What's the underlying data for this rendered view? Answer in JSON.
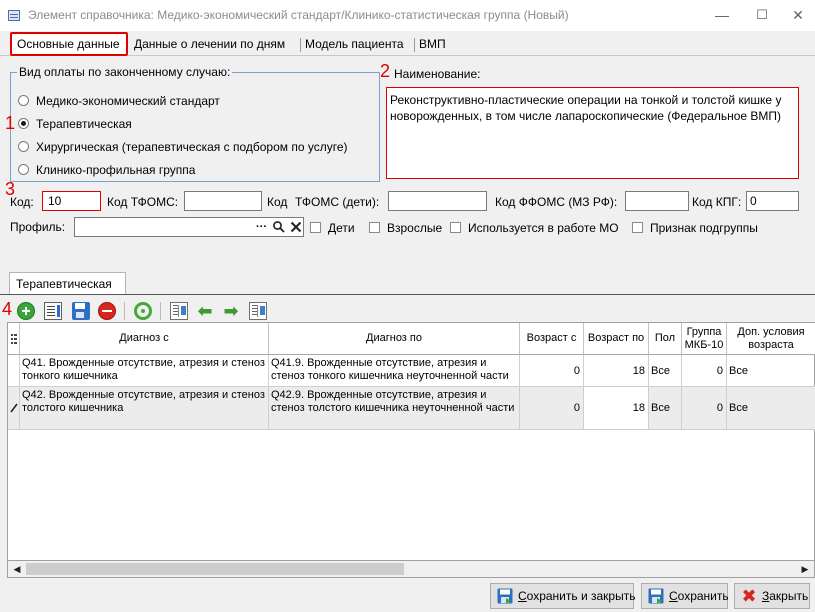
{
  "window": {
    "title": "Элемент справочника: Медико-экономический стандарт/Клинико-статистическая группа (Новый)",
    "minimize": "—",
    "maximize": "☐",
    "close": "✕"
  },
  "tabs": [
    {
      "label": "Основные данные",
      "active": true
    },
    {
      "label": "Данные о лечении по дням"
    },
    {
      "label": "Модель пациента"
    },
    {
      "label": "ВМП"
    }
  ],
  "annotations": [
    "1",
    "2",
    "3",
    "4"
  ],
  "payment": {
    "legend": "Вид оплаты по законченному случаю:",
    "options": [
      {
        "label": "Медико-экономический стандарт",
        "selected": false
      },
      {
        "label": "Терапевтическая",
        "selected": true
      },
      {
        "label": "Хирургическая (терапевтическая с подбором по услуге)",
        "selected": false
      },
      {
        "label": "Клинико-профильная группа",
        "selected": false
      }
    ]
  },
  "name": {
    "label": "Наименование:",
    "value": "Реконструктивно-пластические операции на тонкой и толстой кишке у новорожденных, в том числе лапароскопические (Федеральное ВМП)"
  },
  "codes": {
    "code_label": "Код:",
    "code_value": "10",
    "tfoms_label": "Код ТФОМС:",
    "tfoms_value": "",
    "tfoms_child_label1": "Код",
    "tfoms_child_label2": "ТФОМС (дети):",
    "tfoms_child_value": "",
    "ffoms_label": "Код ФФОМС (МЗ РФ):",
    "ffoms_value": "",
    "kpg_label": "Код КПГ:",
    "kpg_value": "0"
  },
  "profile": {
    "label": "Профиль:",
    "value": "",
    "dots": "···",
    "checkboxes": [
      {
        "label": "Дети",
        "checked": false
      },
      {
        "label": "Взрослые",
        "checked": false
      },
      {
        "label": "Используется в работе МО",
        "checked": false
      },
      {
        "label": "Признак подгруппы",
        "checked": false
      }
    ]
  },
  "subtab": {
    "label": "Терапевтическая"
  },
  "grid": {
    "columns": [
      "Диагноз с",
      "Диагноз по",
      "Возраст с",
      "Возраст по",
      "Пол",
      "Группа МКБ-10",
      "Доп. условия возраста"
    ],
    "rows": [
      {
        "diag_from": "Q41. Врожденные отсутствие, атрезия и стеноз тонкого кишечника",
        "diag_to": "Q41.9. Врожденные отсутствие, атрезия и стеноз тонкого кишечника неуточненной части",
        "age_from": "0",
        "age_to": "18",
        "sex": "Все",
        "group": "0",
        "extra": "Все"
      },
      {
        "diag_from": "Q42. Врожденные отсутствие, атрезия и стеноз толстого кишечника",
        "diag_to": "Q42.9. Врожденные отсутствие, атрезия и стеноз толстого кишечника неуточненной части",
        "age_from": "0",
        "age_to": "18",
        "sex": "Все",
        "group": "0",
        "extra": "Все"
      }
    ]
  },
  "buttons": {
    "save_close": {
      "label_u": "С",
      "label_rest": "охранить и закрыть"
    },
    "save": {
      "label_u": "С",
      "label_rest": "охранить"
    },
    "close": {
      "label_u": "З",
      "label_rest": "акрыть"
    }
  },
  "colors": {
    "accent_red": "#e00000",
    "group_border": "#7ba0cc"
  }
}
